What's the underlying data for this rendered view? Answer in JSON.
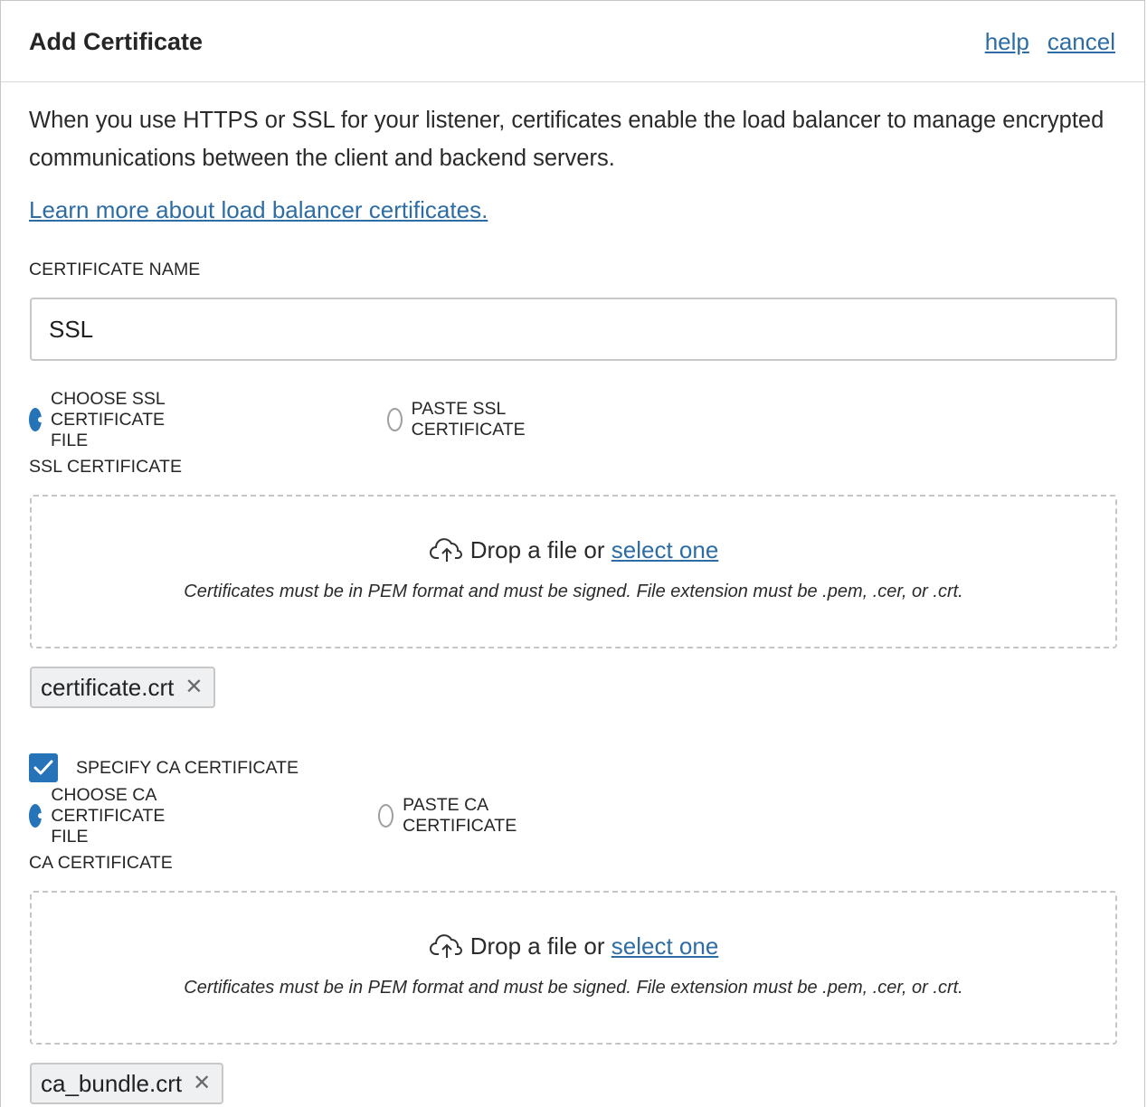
{
  "dialog": {
    "title": "Add Certificate",
    "help_link": "help",
    "cancel_link": "cancel"
  },
  "intro": {
    "text": "When you use HTTPS or SSL for your listener, certificates enable the load balancer to manage encrypted communications between the client and backend servers.",
    "learn_more": "Learn more about load balancer certificates."
  },
  "certificate_name": {
    "label": "CERTIFICATE NAME",
    "value": "SSL"
  },
  "ssl_source": {
    "option_file": "CHOOSE SSL CERTIFICATE FILE",
    "option_paste": "PASTE SSL CERTIFICATE",
    "selected": "file"
  },
  "ssl_certificate": {
    "label": "SSL CERTIFICATE",
    "drop_text": "Drop a file or",
    "select_link": "select one",
    "hint": "Certificates must be in PEM format and must be signed. File extension must be .pem, .cer, or .crt.",
    "file_name": "certificate.crt"
  },
  "specify_ca": {
    "label": "SPECIFY CA CERTIFICATE",
    "checked": true
  },
  "ca_source": {
    "option_file": "CHOOSE CA CERTIFICATE FILE",
    "option_paste": "PASTE CA CERTIFICATE",
    "selected": "file"
  },
  "ca_certificate": {
    "label": "CA CERTIFICATE",
    "drop_text": "Drop a file or",
    "select_link": "select one",
    "hint": "Certificates must be in PEM format and must be signed. File extension must be .pem, .cer, or .crt.",
    "file_name": "ca_bundle.crt"
  },
  "icons": {
    "upload": "cloud-upload-icon",
    "remove": "close-icon",
    "check": "checkmark-icon"
  },
  "colors": {
    "accent": "#2673b9",
    "link": "#2e6da4",
    "border": "#c6c6c6"
  }
}
